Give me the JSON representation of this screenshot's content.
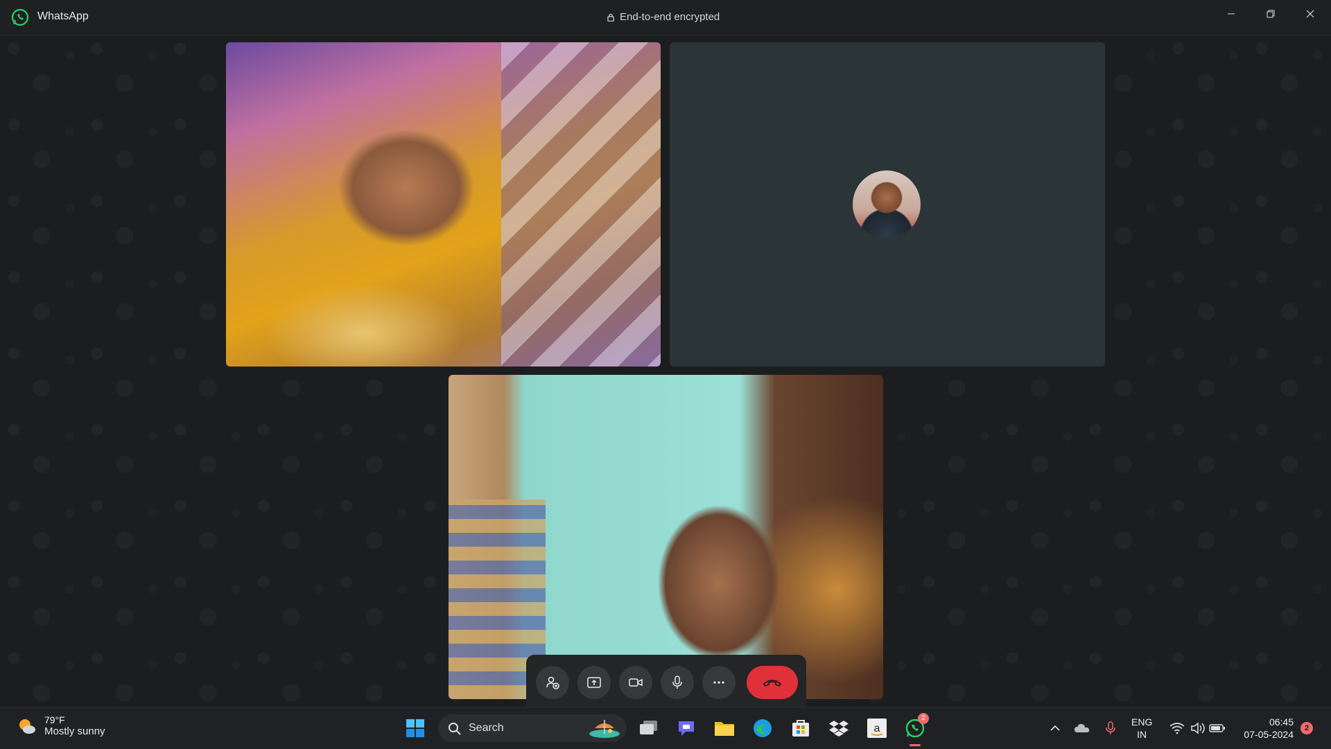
{
  "window": {
    "app_name": "WhatsApp",
    "encryption_notice": "End-to-end encrypted"
  },
  "call": {
    "participants": [
      "participant-video-1",
      "participant-avatar",
      "self-video"
    ],
    "controls": [
      {
        "name": "add-participant",
        "icon": "add-person-icon"
      },
      {
        "name": "share-screen",
        "icon": "share-screen-icon"
      },
      {
        "name": "camera",
        "icon": "video-camera-icon"
      },
      {
        "name": "microphone",
        "icon": "microphone-icon"
      },
      {
        "name": "more-options",
        "icon": "more-dots-icon"
      },
      {
        "name": "end-call",
        "icon": "hang-up-icon"
      }
    ],
    "end_call_color": "#e0303a"
  },
  "taskbar": {
    "weather": {
      "temp": "79°F",
      "condition": "Mostly sunny"
    },
    "search_label": "Search",
    "pinned_apps": [
      "start",
      "search",
      "task-view",
      "teams",
      "file-explorer",
      "edge",
      "store",
      "dropbox",
      "amazon",
      "whatsapp"
    ],
    "whatsapp_badge": "2",
    "language": {
      "line1": "ENG",
      "line2": "IN"
    },
    "time": "06:45",
    "date": "07-05-2024",
    "notification_count": "2"
  }
}
